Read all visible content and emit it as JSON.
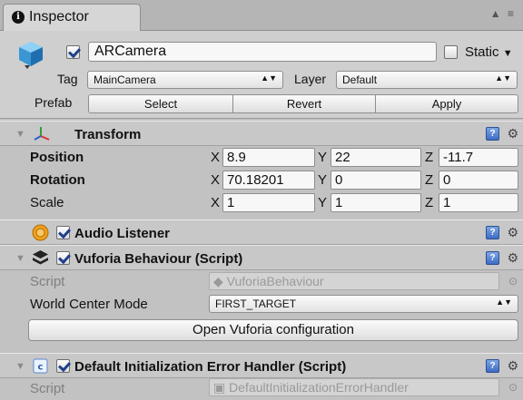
{
  "tab": {
    "title": "Inspector",
    "controls": "▲ ≡"
  },
  "header": {
    "name": "ARCamera",
    "static_label": "Static",
    "tag_label": "Tag",
    "tag_value": "MainCamera",
    "layer_label": "Layer",
    "layer_value": "Default",
    "prefab_label": "Prefab",
    "select_label": "Select",
    "revert_label": "Revert",
    "apply_label": "Apply"
  },
  "transform": {
    "title": "Transform",
    "position_label": "Position",
    "rotation_label": "Rotation",
    "scale_label": "Scale",
    "axis_x": "X",
    "axis_y": "Y",
    "axis_z": "Z",
    "position": {
      "x": "8.9",
      "y": "22",
      "z": "-11.7"
    },
    "rotation": {
      "x": "70.18201",
      "y": "0",
      "z": "0"
    },
    "scale": {
      "x": "1",
      "y": "1",
      "z": "1"
    }
  },
  "audio_listener": {
    "title": "Audio Listener"
  },
  "vuforia": {
    "title": "Vuforia Behaviour (Script)",
    "script_label": "Script",
    "script_value": "VuforiaBehaviour",
    "world_center_label": "World Center Mode",
    "world_center_value": "FIRST_TARGET",
    "open_config_label": "Open Vuforia configuration"
  },
  "error_handler": {
    "title": "Default Initialization Error Handler (Script)",
    "script_label": "Script",
    "script_value": "DefaultInitializationErrorHandler"
  }
}
